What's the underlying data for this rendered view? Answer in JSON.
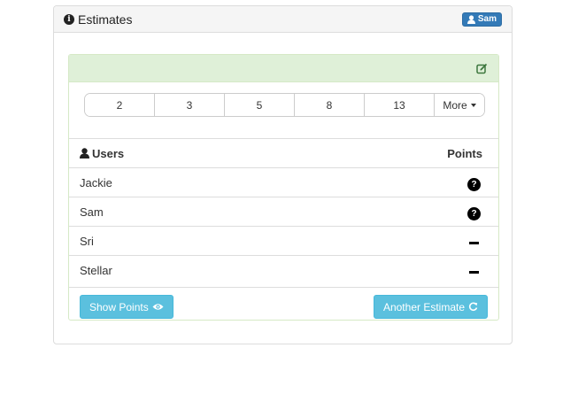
{
  "panel": {
    "title": "Estimates",
    "user": "Sam",
    "title_icon": "info-circle-icon"
  },
  "inner": {
    "edit_icon": "edit-icon"
  },
  "point_options": [
    "2",
    "3",
    "5",
    "8",
    "13"
  ],
  "more_label": "More",
  "table": {
    "headers": {
      "users": "Users",
      "points": "Points"
    },
    "rows": [
      {
        "name": "Jackie",
        "status": "question"
      },
      {
        "name": "Sam",
        "status": "question"
      },
      {
        "name": "Sri",
        "status": "dash"
      },
      {
        "name": "Stellar",
        "status": "dash"
      }
    ]
  },
  "buttons": {
    "show_points": "Show Points",
    "another_estimate": "Another Estimate"
  },
  "colors": {
    "info": "#5bc0de",
    "primary": "#337ab7",
    "success_bg": "#dff0d8",
    "success_icon": "#3c763d"
  }
}
